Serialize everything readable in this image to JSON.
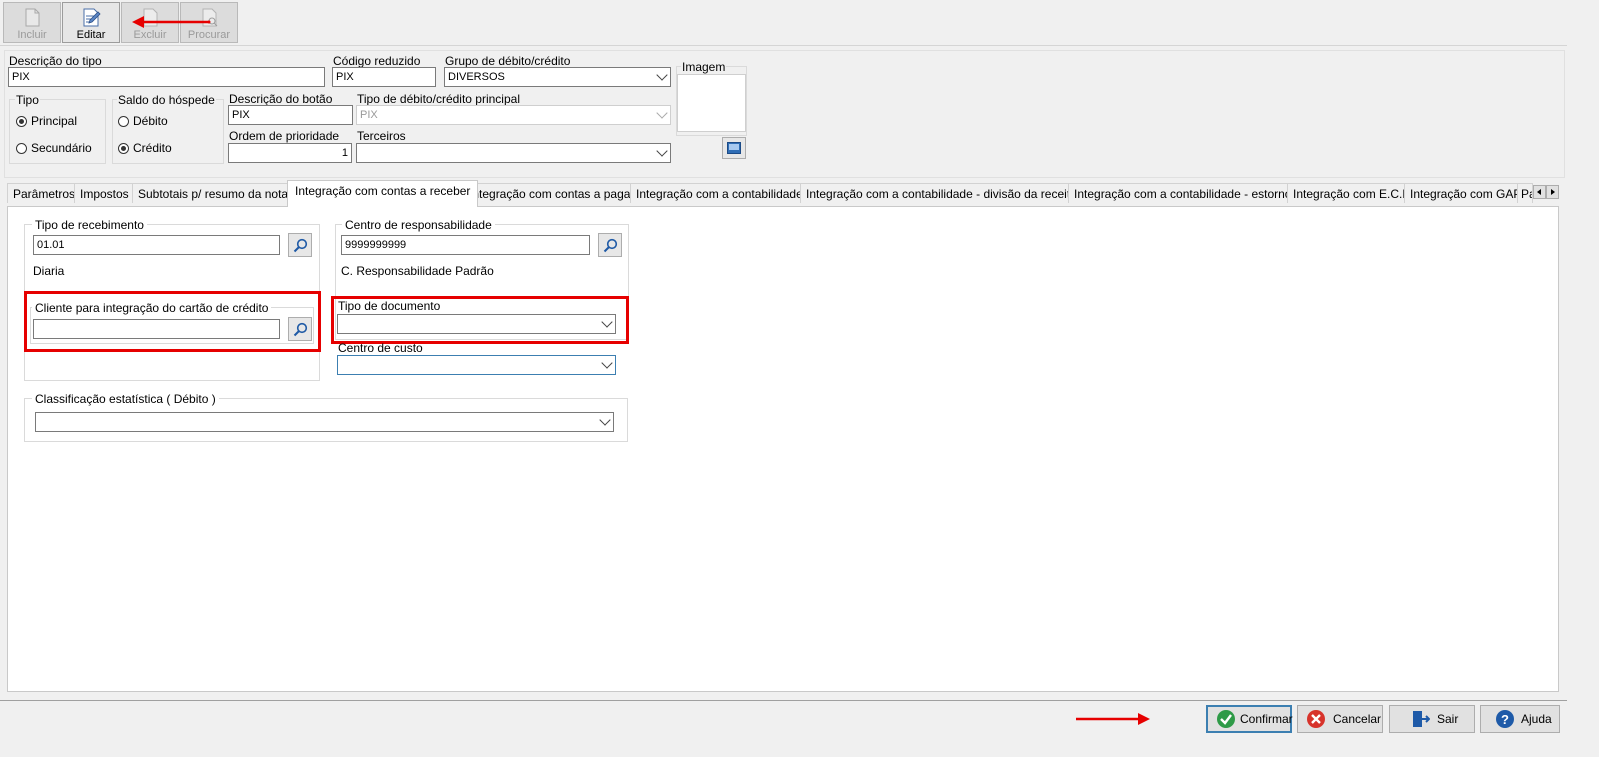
{
  "toolbar": {
    "incluir": "Incluir",
    "editar": "Editar",
    "excluir": "Excluir",
    "procurar": "Procurar"
  },
  "header": {
    "descricao_tipo_label": "Descrição do tipo",
    "descricao_tipo_value": "PIX",
    "codigo_reduzido_label": "Código reduzido",
    "codigo_reduzido_value": "PIX",
    "grupo_label": "Grupo de débito/crédito",
    "grupo_value": "DIVERSOS",
    "imagem_label": "Imagem",
    "tipo_label": "Tipo",
    "tipo_principal": "Principal",
    "tipo_secundario": "Secundário",
    "saldo_label": "Saldo do hóspede",
    "saldo_debito": "Débito",
    "saldo_credito": "Crédito",
    "desc_botao_label": "Descrição do botão",
    "desc_botao_value": "PIX",
    "tipo_principal_label": "Tipo de débito/crédito principal",
    "tipo_principal_value": "PIX",
    "ordem_label": "Ordem de prioridade",
    "ordem_value": "1",
    "terceiros_label": "Terceiros",
    "terceiros_value": ""
  },
  "tabs": [
    "Parâmetros",
    "Impostos",
    "Subtotais p/ resumo da nota",
    "Integração com contas a receber",
    "Integração com contas a pagar",
    "Integração com a contabilidade",
    "Integração com a contabilidade - divisão da receita",
    "Integração com a contabilidade - estorno",
    "Integração com E.C.F",
    "Integração com GAP",
    "Pa"
  ],
  "panel": {
    "tipo_recebimento_label": "Tipo de recebimento",
    "tipo_recebimento_value": "01.01",
    "tipo_recebimento_desc": "Diaria",
    "cliente_label": "Cliente para integração do cartão de crédito",
    "cliente_value": "",
    "centro_resp_label": "Centro de responsabilidade",
    "centro_resp_value": "9999999999",
    "centro_resp_desc": "C. Responsabilidade Padrão",
    "tipo_documento_label": "Tipo de documento",
    "tipo_documento_value": "",
    "centro_custo_label": "Centro de custo",
    "centro_custo_value": "",
    "classificacao_label": "Classificação estatística ( Débito )",
    "classificacao_value": ""
  },
  "footer": {
    "confirmar": "Confirmar",
    "cancelar": "Cancelar",
    "sair": "Sair",
    "ajuda": "Ajuda"
  },
  "colors": {
    "highlight": "#e60000",
    "arrow": "#e60000",
    "focus_border": "#3c7fb1"
  }
}
